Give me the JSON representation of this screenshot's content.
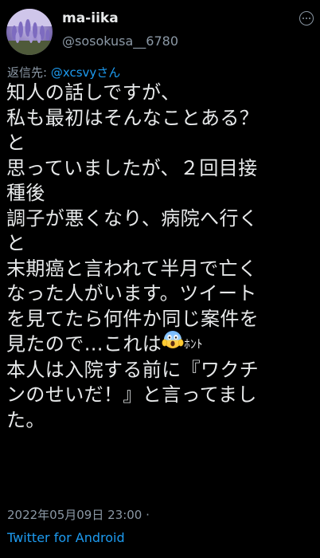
{
  "author": {
    "display_name": "ma-iika",
    "handle": "@sosokusa__6780"
  },
  "reply": {
    "prefix": "返信先: ",
    "mention": "@xcsvyさん"
  },
  "tweet": {
    "lines": [
      "知人の話しですが、",
      "私も最初はそんなことある？",
      "と",
      "思っていましたが、２回目接",
      "種後",
      "調子が悪くなり、病院へ行く",
      "と",
      "末期癌と言われて半月で亡く",
      "なった人がいます。ツイート",
      "を見てたら何件か同じ案件を",
      "見たので…これは",
      "本人は入院する前に『ワクチ",
      "ンのせいだ！』と言ってまし",
      "た。"
    ],
    "emoji_icon": "face-screaming-in-fear-icon",
    "emoji_suffix": "ﾎﾝﾄ"
  },
  "meta": {
    "timestamp": "2022年05月09日 23:00 ·",
    "source": "Twitter for Android"
  },
  "colors": {
    "background": "#000000",
    "text": "#e7e9ea",
    "secondary": "#8b98a5",
    "link": "#1d9bf0"
  }
}
